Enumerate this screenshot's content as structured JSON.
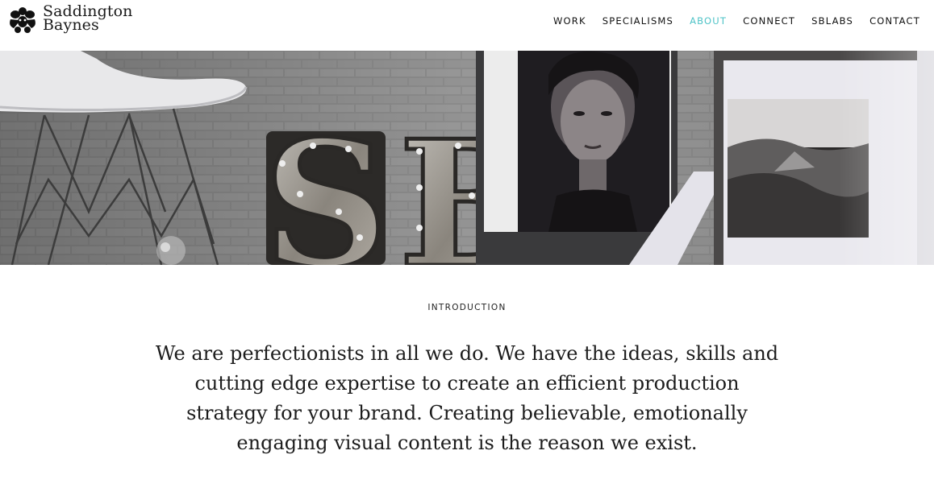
{
  "brand": {
    "line1": "Saddington",
    "line2": "Baynes"
  },
  "nav": {
    "items": [
      {
        "label": "WORK",
        "active": false
      },
      {
        "label": "SPECIALISMS",
        "active": false
      },
      {
        "label": "ABOUT",
        "active": true
      },
      {
        "label": "CONNECT",
        "active": false
      },
      {
        "label": "SBLABS",
        "active": false
      },
      {
        "label": "CONTACT",
        "active": false
      }
    ],
    "active_color": "#4ec3c7"
  },
  "hero": {
    "image": "SB marquee letters with chair and framed portraits",
    "letters": "SB"
  },
  "intro": {
    "label": "INTRODUCTION",
    "text": "We are perfectionists in all we do. We have the ideas, skills and cutting edge expertise to create an efficient production strategy for your brand. Creating believable, emotionally engaging visual content is the reason we exist."
  }
}
